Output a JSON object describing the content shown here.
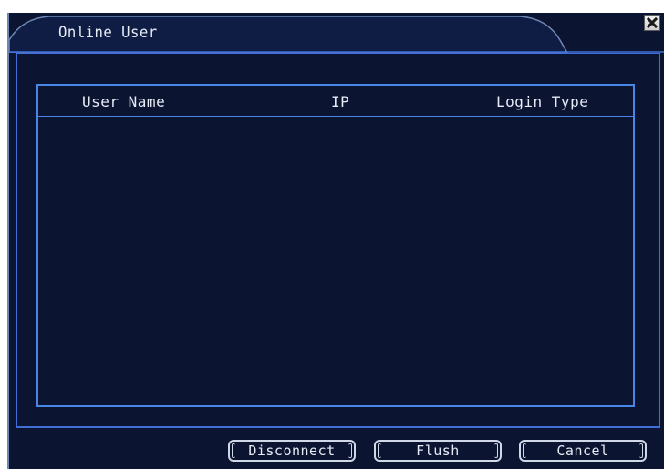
{
  "dialog": {
    "title": "Online User",
    "close_icon": "close-x-icon"
  },
  "table": {
    "columns": [
      "User Name",
      "IP",
      "Login Type"
    ],
    "rows": []
  },
  "buttons": {
    "disconnect": "Disconnect",
    "flush": "Flush",
    "cancel": "Cancel"
  },
  "colors": {
    "background": "#0b1430",
    "accent": "#4a86e8",
    "title_bar": "#0f1d45",
    "text": "#e7ecf6"
  }
}
